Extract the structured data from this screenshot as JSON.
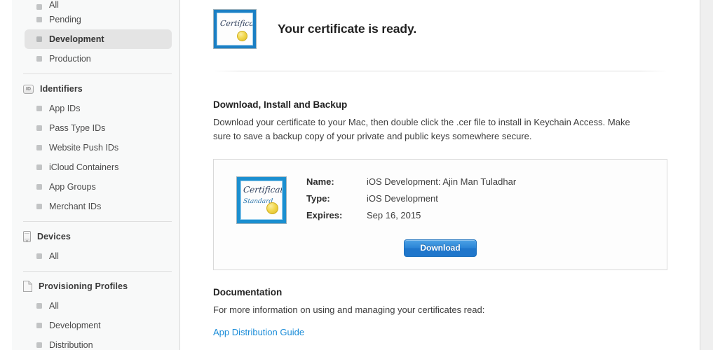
{
  "sidebar": {
    "sections": [
      {
        "header": null,
        "items": [
          {
            "label": "All",
            "selected": false,
            "clipped": true
          },
          {
            "label": "Pending",
            "selected": false
          },
          {
            "label": "Development",
            "selected": true
          },
          {
            "label": "Production",
            "selected": false
          }
        ]
      },
      {
        "header": {
          "label": "Identifiers",
          "icon": "id-badge-icon"
        },
        "items": [
          {
            "label": "App IDs",
            "selected": false
          },
          {
            "label": "Pass Type IDs",
            "selected": false
          },
          {
            "label": "Website Push IDs",
            "selected": false
          },
          {
            "label": "iCloud Containers",
            "selected": false
          },
          {
            "label": "App Groups",
            "selected": false
          },
          {
            "label": "Merchant IDs",
            "selected": false
          }
        ]
      },
      {
        "header": {
          "label": "Devices",
          "icon": "device-icon"
        },
        "items": [
          {
            "label": "All",
            "selected": false
          }
        ]
      },
      {
        "header": {
          "label": "Provisioning Profiles",
          "icon": "document-icon"
        },
        "items": [
          {
            "label": "All",
            "selected": false
          },
          {
            "label": "Development",
            "selected": false
          },
          {
            "label": "Distribution",
            "selected": false
          }
        ]
      }
    ]
  },
  "main": {
    "hero": {
      "title": "Your certificate is ready.",
      "icon": "certificate-icon",
      "icon_text": "Certificate"
    },
    "download_section": {
      "title": "Download, Install and Backup",
      "body": "Download your certificate to your Mac, then double click the .cer file to install in Keychain Access. Make sure to save a backup copy of your private and public keys somewhere secure."
    },
    "certificate": {
      "icon": "certificate-icon",
      "icon_text_primary": "Certificate",
      "icon_text_secondary": "Standard",
      "fields": [
        {
          "label": "Name:",
          "value": "iOS Development: Ajin Man Tuladhar"
        },
        {
          "label": "Type:",
          "value": "iOS Development"
        },
        {
          "label": "Expires:",
          "value": "Sep 16, 2015"
        }
      ],
      "download_button": "Download"
    },
    "documentation": {
      "title": "Documentation",
      "body": "For more information on using and managing your certificates read:",
      "link": "App Distribution Guide"
    }
  },
  "colors": {
    "accent_blue": "#1f76cb",
    "link_blue": "#1a8cd8",
    "sidebar_bg": "#f8f9f9",
    "selected_bg": "#e4e4e4",
    "cert_border_blue": "#1b7fc4",
    "seal_gold": "#f2d84f"
  }
}
